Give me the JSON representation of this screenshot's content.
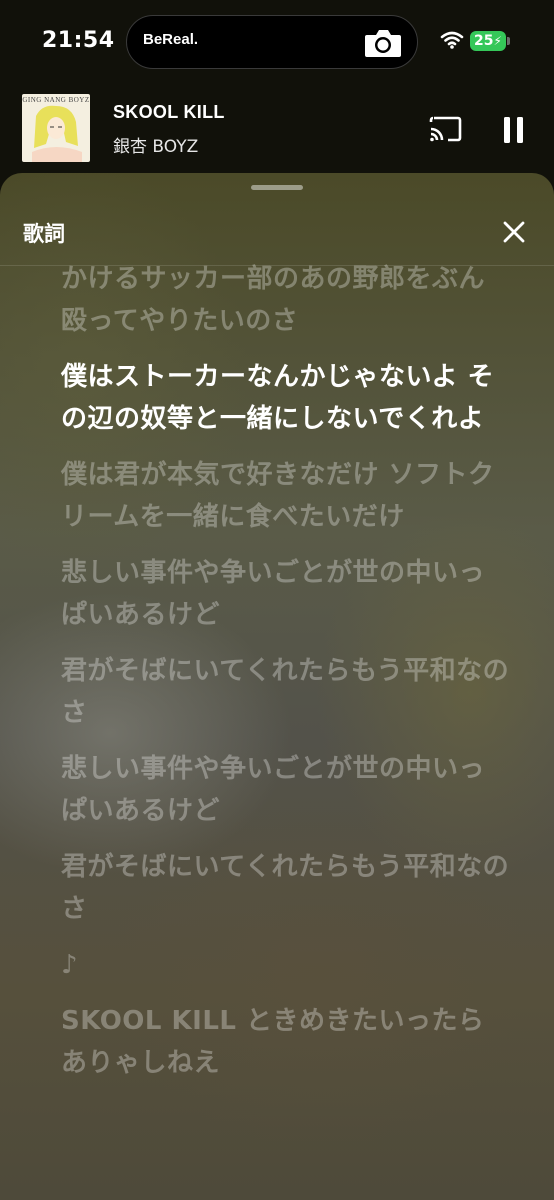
{
  "status_bar": {
    "time": "21:54",
    "island_app": "BeReal.",
    "battery": "25"
  },
  "now_playing": {
    "title": "SKOOL KILL",
    "artist": "銀杏 BOYZ",
    "cover_text": "GING NANG BOYZ"
  },
  "sheet": {
    "title": "歌詞"
  },
  "lyrics": [
    {
      "text": "かけるサッカー部のあの野郎をぶん殴ってやりたいのさ",
      "active": false
    },
    {
      "text": "僕はストーカーなんかじゃないよ その辺の奴等と一緒にしないでくれよ",
      "active": true
    },
    {
      "text": "僕は君が本気で好きなだけ ソフトクリームを一緒に食べたいだけ",
      "active": false
    },
    {
      "text": "悲しい事件や争いごとが世の中いっぱいあるけど",
      "active": false
    },
    {
      "text": "君がそばにいてくれたらもう平和なのさ",
      "active": false
    },
    {
      "text": "悲しい事件や争いごとが世の中いっぱいあるけど",
      "active": false
    },
    {
      "text": "君がそばにいてくれたらもう平和なのさ",
      "active": false
    },
    {
      "text": "♪",
      "active": false
    },
    {
      "text": "SKOOL KILL ときめきたいったらありゃしねえ",
      "active": false
    }
  ],
  "icons": {
    "camera": "camera-icon",
    "wifi": "wifi-icon",
    "cast": "cast-icon",
    "pause": "pause-icon",
    "close": "close-icon"
  },
  "colors": {
    "battery": "#35c759",
    "active_lyric": "#ffffff"
  }
}
